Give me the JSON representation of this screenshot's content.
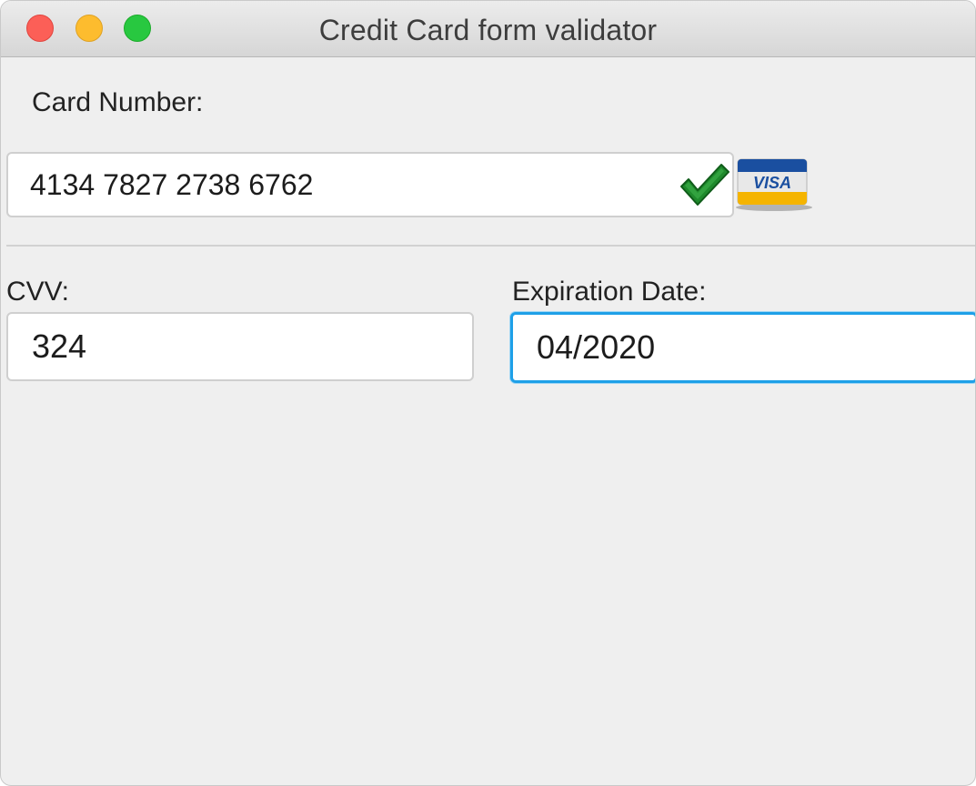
{
  "window": {
    "title": "Credit Card form validator"
  },
  "card_number": {
    "label": "Card Number:",
    "value": "4134 7827 2738 6762",
    "valid_icon": "checkmark-icon",
    "card_brand_icon": "visa-card-icon",
    "card_brand_text": "VISA"
  },
  "cvv": {
    "label": "CVV:",
    "value": "324"
  },
  "expiration": {
    "label": "Expiration Date:",
    "value": "04/2020"
  },
  "colors": {
    "focus_border": "#1ea0e8",
    "check_green": "#1f8a2c",
    "visa_blue": "#1a4fa0",
    "visa_gold": "#f5b400"
  }
}
